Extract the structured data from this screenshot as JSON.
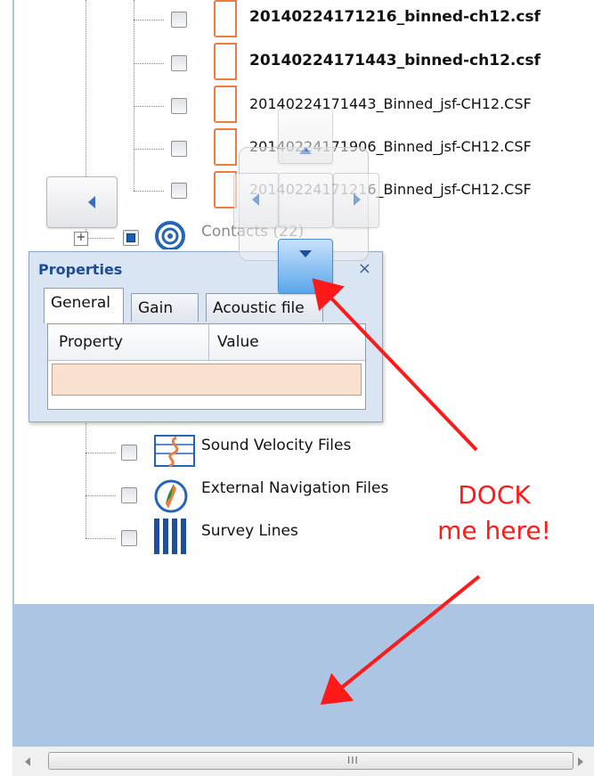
{
  "files": [
    {
      "name": "20140224171216_binned-ch12.csf",
      "bold": true
    },
    {
      "name": "20140224171443_binned-ch12.csf",
      "bold": true
    },
    {
      "name": "20140224171443_Binned_jsf-CH12.CSF",
      "bold": false
    },
    {
      "name": "20140224171906_Binned_jsf-CH12.CSF",
      "bold": false
    },
    {
      "name": "20140224171216_Binned_jsf-CH12.CSF",
      "bold": false
    }
  ],
  "contacts_label": "Contacts (22)",
  "categories": [
    {
      "label": "Sound Velocity Files",
      "icon": "sound-velocity-icon"
    },
    {
      "label": "External Navigation Files",
      "icon": "compass-icon"
    },
    {
      "label": "Survey Lines",
      "icon": "survey-lines-icon"
    }
  ],
  "properties": {
    "title": "Properties",
    "close": "×",
    "tabs": [
      "General",
      "Gain",
      "Acoustic file"
    ],
    "active_tab": "General",
    "columns": [
      "Property",
      "Value"
    ]
  },
  "annotation": "DOCK\nme here!",
  "colors": {
    "annotation": "#ff1a1a",
    "dock_zone": "#abc5e3",
    "file_icon": "#ef7c3c",
    "property_row": "#f9e0cf"
  }
}
